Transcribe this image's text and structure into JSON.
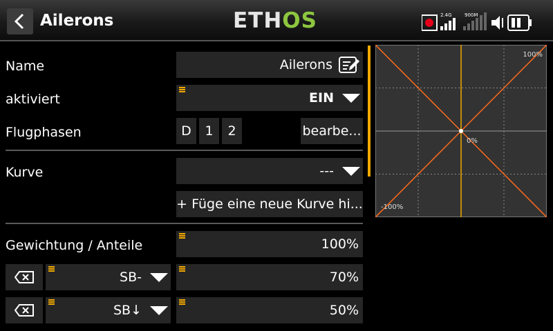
{
  "header": {
    "title": "Ailerons",
    "logo_part1": "ETH",
    "logo_part2": "OS",
    "rf_label_1": "2.4G",
    "rf_label_2": "900M"
  },
  "form": {
    "name_label": "Name",
    "name_value": "Ailerons",
    "enabled_label": "aktiviert",
    "enabled_value": "EIN",
    "phases_label": "Flugphasen",
    "phases": [
      "D",
      "1",
      "2"
    ],
    "phases_edit": "bearbe...",
    "curve_label": "Kurve",
    "curve_value": "---",
    "add_curve": "+ Füge eine neue Kurve hi...",
    "weight_label": "Gewichtung / Anteile",
    "weight_value": "100%",
    "rows": [
      {
        "source": "SB-",
        "value": "70%"
      },
      {
        "source": "SB↓",
        "value": "50%"
      }
    ]
  },
  "graph": {
    "top_label": "100%",
    "center_label": "0%",
    "bottom_label": "-100%"
  },
  "chart_data": {
    "type": "line",
    "x": [
      -100,
      0,
      100
    ],
    "series": [
      {
        "values": [
          -100,
          0,
          100
        ]
      },
      {
        "values": [
          100,
          0,
          -100
        ]
      }
    ],
    "xlim": [
      -100,
      100
    ],
    "ylim": [
      -100,
      100
    ],
    "grid": true
  },
  "colors": {
    "accent": "#f2a900",
    "curve": "#ff6a1a",
    "logo_green": "#8dc63f",
    "record": "#e5001a"
  }
}
